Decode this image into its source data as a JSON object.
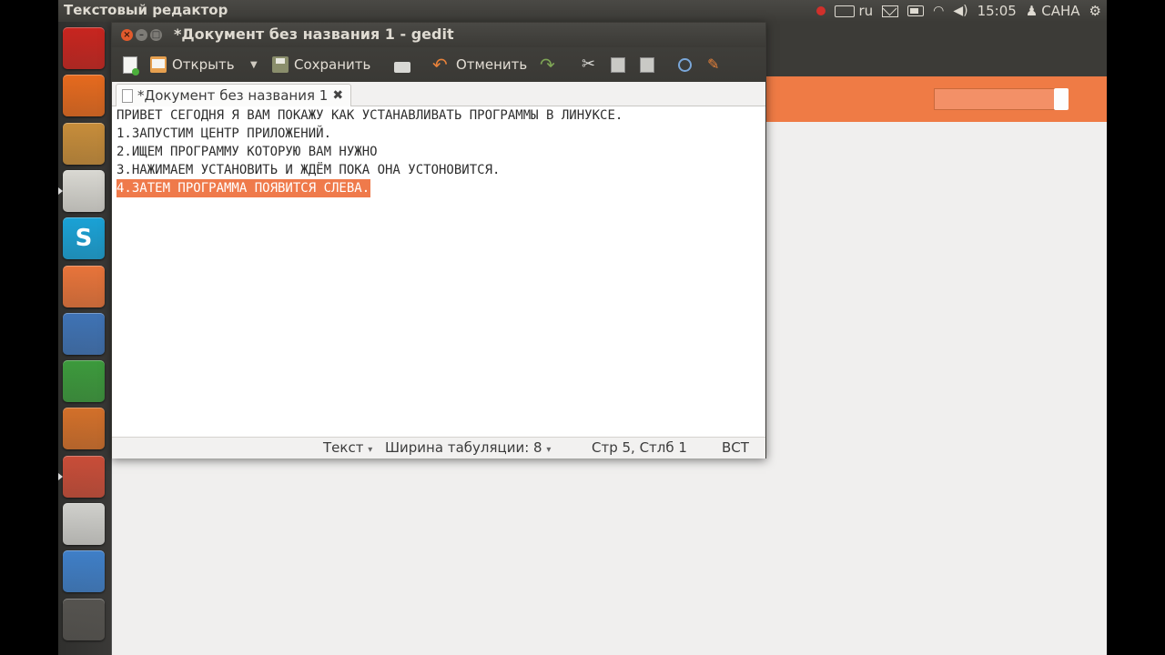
{
  "panel": {
    "app_title": "Текстовый редактор",
    "keyboard_layout": "ru",
    "time": "15:05",
    "user": "САНА"
  },
  "launcher": {
    "items": [
      {
        "name": "opera",
        "color": "#c8251f"
      },
      {
        "name": "firefox",
        "color": "#e66a1e"
      },
      {
        "name": "rhythmbox",
        "color": "#c78d3a"
      },
      {
        "name": "gedit",
        "color": "#d9d8d2"
      },
      {
        "name": "skype",
        "color": "#1aa2d6",
        "glyph": "S"
      },
      {
        "name": "files",
        "color": "#e8743a"
      },
      {
        "name": "libreoffice-writer",
        "color": "#3f73b5"
      },
      {
        "name": "libreoffice-calc",
        "color": "#3c9a3c"
      },
      {
        "name": "libreoffice-impress",
        "color": "#d3702a"
      },
      {
        "name": "ubuntu-software-center",
        "color": "#c94d38"
      },
      {
        "name": "mail",
        "color": "#d0d0cc"
      },
      {
        "name": "empathy",
        "color": "#3f7fc8"
      },
      {
        "name": "trash",
        "color": "#55534f"
      }
    ]
  },
  "window": {
    "title": "*Документ без названия 1 - gedit",
    "toolbar": {
      "open_label": "Открыть",
      "save_label": "Сохранить",
      "undo_label": "Отменить"
    },
    "tab_label": "*Документ без названия 1",
    "lines": [
      "ПРИВЕТ СЕГОДНЯ Я ВАМ ПОКАЖУ КАК УСТАНАВЛИВАТЬ ПРОГРАММЫ В ЛИНУКСЕ.",
      "1.ЗАПУСТИМ ЦЕНТР ПРИЛОЖЕНИЙ.",
      "2.ИЩЕМ ПРОГРАММУ КОТОРУЮ ВАМ НУЖНО",
      "3.НАЖИМАЕМ УСТАНОВИТЬ И ЖДЁМ ПОКА ОНА УСТОНОВИТСЯ.",
      "4.ЗАТЕМ ПРОГРАММА ПОЯВИТСЯ СЛЕВА."
    ],
    "status": {
      "language": "Текст",
      "tab_width_label": "Ширина табуляции:",
      "tab_width": "8",
      "position": "Стр 5, Стлб 1",
      "mode": "ВСТ"
    }
  },
  "colors": {
    "selection": "#ef7a4b",
    "accent_orange": "#ef7b45",
    "panel_dark": "#3c3b37"
  }
}
